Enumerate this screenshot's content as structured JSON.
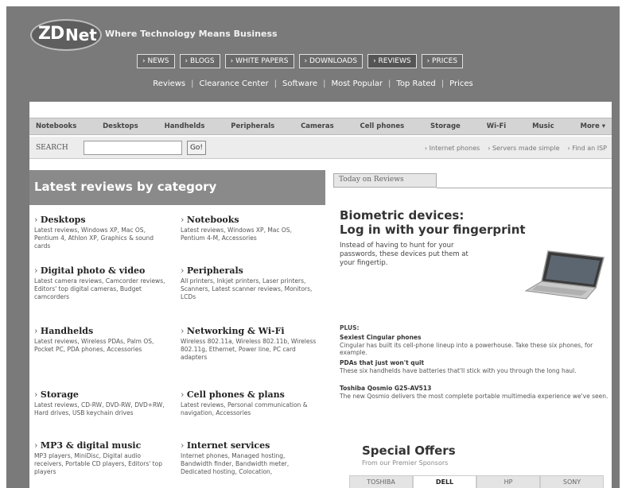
{
  "header": {
    "logo_zd": "ZD",
    "logo_net": "Net",
    "tagline": "Where Technology Means Business",
    "nav": [
      "› NEWS",
      "› BLOGS",
      "› WHITE PAPERS",
      "› DOWNLOADS",
      "› REVIEWS",
      "› PRICES"
    ],
    "subnav": [
      "Reviews",
      "Clearance Center",
      "Software",
      "Most Popular",
      "Top Rated",
      "Prices"
    ]
  },
  "categories_bar": [
    "Notebooks",
    "Desktops",
    "Handhelds",
    "Peripherals",
    "Cameras",
    "Cell phones",
    "Storage",
    "Wi-Fi",
    "Music",
    "More ▾"
  ],
  "search": {
    "label": "SEARCH",
    "value": "",
    "go_label": "Go!",
    "quicklinks": [
      "Internet phones",
      "Servers made simple",
      "Find an ISP"
    ]
  },
  "left": {
    "header": "Latest reviews by category",
    "categories": [
      {
        "title": "Desktops",
        "desc": "Latest reviews, Windows XP, Mac OS, Pentium 4, Athlon XP, Graphics & sound cards"
      },
      {
        "title": "Notebooks",
        "desc": "Latest reviews, Windows XP, Mac OS, Pentium 4-M, Accessories"
      },
      {
        "title": "Digital photo & video",
        "desc": "Latest camera reviews, Camcorder reviews, Editors' top digital cameras, Budget camcorders"
      },
      {
        "title": "Peripherals",
        "desc": "All printers, Inkjet printers, Laser printers, Scanners, Latest scanner reviews, Monitors, LCDs"
      },
      {
        "title": "Handhelds",
        "desc": "Latest reviews, Wireless PDAs, Palm OS, Pocket PC, PDA phones, Accessories"
      },
      {
        "title": "Networking & Wi-Fi",
        "desc": "Wireless 802.11a, Wireless 802.11b, Wireless 802.11g, Ethernet, Power line, PC card adapters"
      },
      {
        "title": "Storage",
        "desc": "Latest reviews, CD-RW, DVD-RW, DVD+RW, Hard drives, USB keychain drives"
      },
      {
        "title": "Cell phones & plans",
        "desc": "Latest reviews, Personal communication & navigation, Accessories"
      },
      {
        "title": "MP3 & digital music",
        "desc": "MP3 players, MiniDisc, Digital audio receivers, Portable CD players, Editors' top players"
      },
      {
        "title": "Internet services",
        "desc": "Internet phones, Managed hosting, Bandwidth finder, Bandwidth meter, Dedicated hosting, Colocation,"
      }
    ]
  },
  "right": {
    "tab": "Today on Reviews",
    "headline_1": "Biometric devices:",
    "headline_2": "Log in with your fingerprint",
    "intro": "Instead of having to hunt for your passwords, these devices put them at your fingertip.",
    "plus_label": "PLUS:",
    "plus_items": [
      {
        "title": "Sexiest Cingular phones",
        "text": "Cingular has built its cell-phone lineup into a powerhouse. Take these six phones, for example."
      },
      {
        "title": "PDAs that just won't quit",
        "text": "These six handhelds have batteries that'll stick with you through the long haul."
      },
      {
        "title": "Toshiba Qosmio G25-AV513",
        "text": "The new Qosmio delivers the most complete portable multimedia experience we've seen."
      }
    ],
    "offers_title": "Special Offers",
    "offers_sub": "From our Premier Sponsors",
    "offer_tabs": [
      "TOSHIBA",
      "DELL",
      "HP",
      "SONY"
    ]
  },
  "colors": {
    "frame_gray": "#7a7a7a",
    "header_bar": "#8a8a8a",
    "category_bar": "#d4d4d4"
  }
}
